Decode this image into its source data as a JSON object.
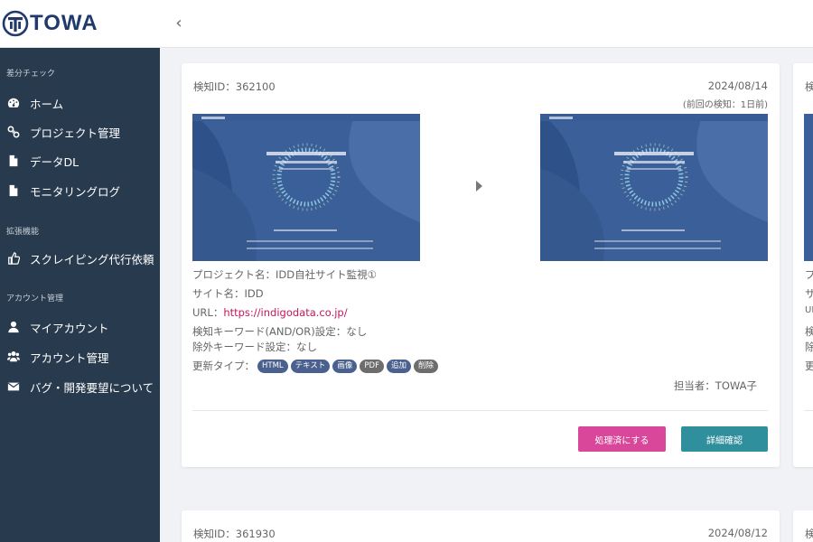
{
  "app": {
    "logo_text": "TOWA",
    "collapse_icon": "‹"
  },
  "sidebar": {
    "sections": [
      {
        "label": "差分チェック"
      },
      {
        "label": "拡張機能"
      },
      {
        "label": "アカウント管理"
      }
    ],
    "items": [
      {
        "label": "ホーム",
        "icon": "dashboard-icon"
      },
      {
        "label": "プロジェクト管理",
        "icon": "link-icon"
      },
      {
        "label": "データDL",
        "icon": "file-icon"
      },
      {
        "label": "モニタリングログ",
        "icon": "file-icon"
      },
      {
        "label": "スクレイピング代行依頼",
        "icon": "hand-pointer-icon"
      },
      {
        "label": "マイアカウント",
        "icon": "user-icon"
      },
      {
        "label": "アカウント管理",
        "icon": "users-icon"
      },
      {
        "label": "バグ・開発要望について",
        "icon": "envelope-icon"
      }
    ]
  },
  "cards": [
    {
      "detection_id": "検知ID：362100",
      "date": "2024/08/14",
      "previous_detection": "(前回の検知：1日前)",
      "project_name": "プロジェクト名：IDD自社サイト監視①",
      "site_name": "サイト名：IDD",
      "url_label": "URL：",
      "url": "https://indigodata.co.jp/",
      "keyword_setting": "検知キーワード(AND/OR)設定：なし",
      "exclude_keyword": "除外キーワード設定：なし",
      "update_type_label": "更新タイプ：",
      "tags": [
        {
          "label": "HTML",
          "color": "#4a6190"
        },
        {
          "label": "テキスト",
          "color": "#4a6190"
        },
        {
          "label": "画像",
          "color": "#4a6190"
        },
        {
          "label": "PDF",
          "color": "#6d6d6d"
        },
        {
          "label": "追加",
          "color": "#4a6190"
        },
        {
          "label": "削除",
          "color": "#6d6d6d"
        }
      ],
      "assignee": "担当者：TOWA子",
      "buttons": {
        "done": "処理済にする",
        "detail": "詳細確認"
      },
      "colors": {
        "done": "#d9479a",
        "detail": "#2f8f9d"
      }
    },
    {
      "detection_id": "検知ID：361930",
      "date": "2024/08/12"
    }
  ],
  "side_card": {
    "lines": [
      "検",
      "プ",
      "サ",
      "UI",
      "検",
      "除",
      "更"
    ]
  }
}
